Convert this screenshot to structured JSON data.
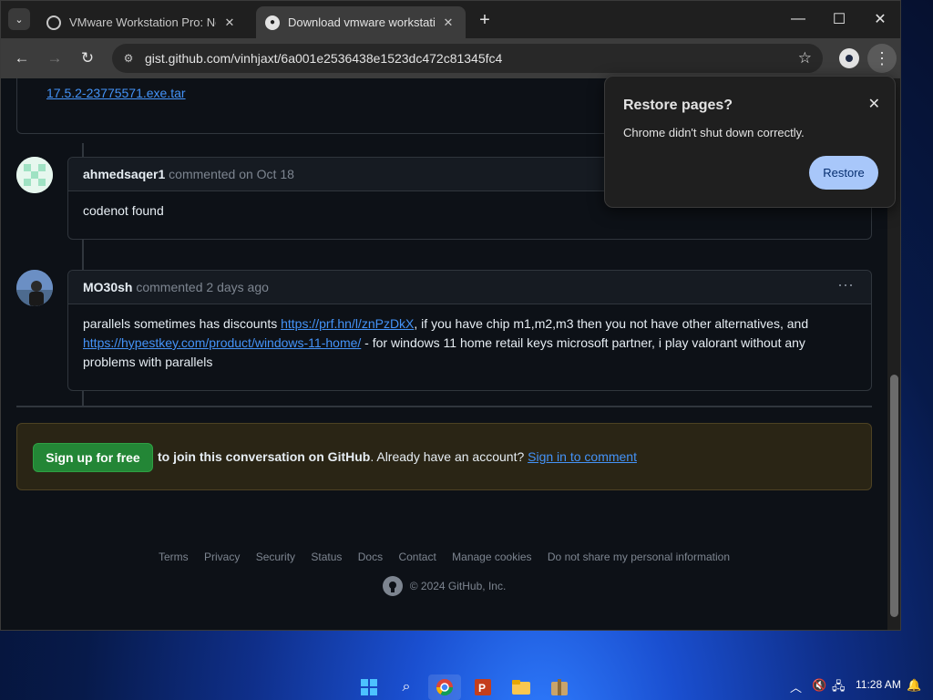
{
  "browser": {
    "tabs": [
      {
        "title": "VMware Workstation Pro: Now",
        "active": false
      },
      {
        "title": "Download vmware workstation",
        "active": true
      }
    ],
    "url": "gist.github.com/vinhjaxt/6a001e2536438e1523dc472c81345fc4"
  },
  "page": {
    "top_link": "17.5.2-23775571.exe.tar",
    "comments": [
      {
        "author": "ahmedsaqer1",
        "meta": "commented on Oct 18",
        "body": "codenot found"
      },
      {
        "author": "MO30sh",
        "meta": "commented 2 days ago",
        "body_part1": "parallels sometimes has discounts ",
        "link1": "https://prf.hn/l/znPzDkX",
        "body_part2": ", if you have chip m1,m2,m3 then you not have other alternatives, and ",
        "link2": "https://hypestkey.com/product/windows-11-home/",
        "body_part3": " - for windows 11 home retail keys microsoft partner, i play valorant without any problems with parallels"
      }
    ],
    "signup": {
      "button": "Sign up for free",
      "text_bold": "to join this conversation on GitHub",
      "text_rest": ". Already have an account? ",
      "signin_link": "Sign in to comment"
    },
    "footer": {
      "links": [
        "Terms",
        "Privacy",
        "Security",
        "Status",
        "Docs",
        "Contact",
        "Manage cookies",
        "Do not share my personal information"
      ],
      "copyright": "© 2024 GitHub, Inc."
    }
  },
  "restore_popup": {
    "title": "Restore pages?",
    "message": "Chrome didn't shut down correctly.",
    "button": "Restore"
  },
  "taskbar": {
    "time": "11:28 AM"
  },
  "colors": {
    "github_bg": "#0d1117",
    "link": "#4493f8",
    "signup_green": "#238636",
    "restore_button": "#a8c7fa"
  }
}
